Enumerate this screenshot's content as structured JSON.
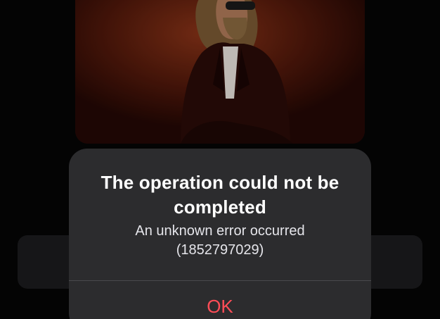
{
  "alert": {
    "title": "The operation could not be completed",
    "message": "An unknown error occurred (1852797029)",
    "ok_label": "OK"
  },
  "colors": {
    "alert_background": "#2c2c2e",
    "button_text": "#ff4d57",
    "artwork_tone": "#5c1d0d"
  }
}
